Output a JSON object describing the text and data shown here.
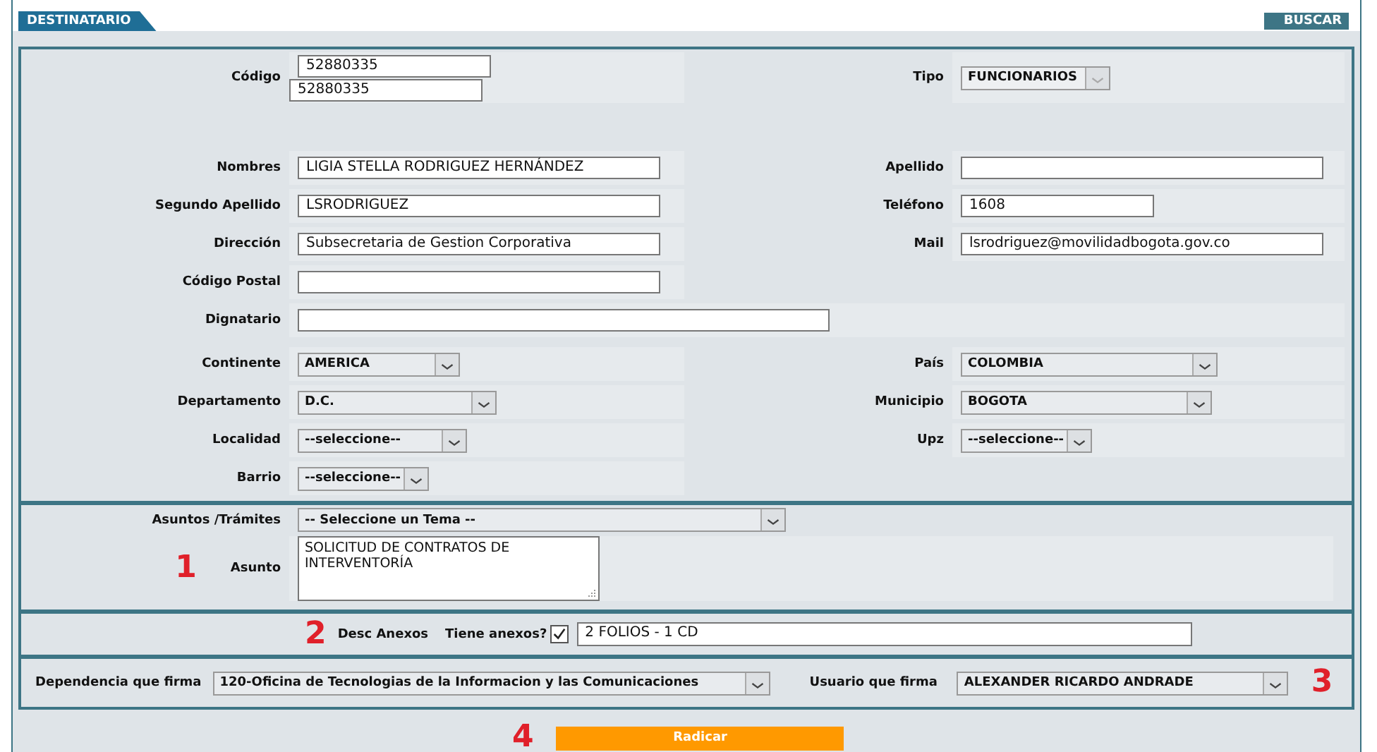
{
  "header": {
    "tab": "DESTINATARIO",
    "search_button": "BUSCAR"
  },
  "recipient": {
    "code_row": {
      "left": {
        "label": "Código",
        "kind": "double",
        "values": [
          "52880335",
          "52880335"
        ]
      },
      "right": {
        "label": "Tipo",
        "kind": "select",
        "value": "FUNCIONARIOS",
        "disabled": true
      }
    },
    "contact_rows": [
      {
        "left": {
          "label": "Nombres",
          "kind": "text",
          "value": "LIGIA STELLA RODRIGUEZ HERNÁNDEZ"
        },
        "right": {
          "label": "Apellido",
          "kind": "text"
        }
      },
      {
        "left": {
          "label": "Segundo Apellido",
          "kind": "text",
          "value": "LSRODRIGUEZ"
        },
        "right": {
          "label": "Teléfono",
          "kind": "text",
          "value": "1608"
        }
      },
      {
        "left": {
          "label": "Dirección",
          "kind": "text",
          "value": "Subsecretaria de Gestion Corporativa"
        },
        "right": {
          "label": "Mail",
          "kind": "text",
          "value": "lsrodriguez@movilidadbogota.gov.co"
        }
      },
      {
        "left": {
          "label": "Código Postal",
          "kind": "text"
        }
      },
      {
        "left": {
          "label": "Dignatario",
          "kind": "wide_text"
        }
      }
    ],
    "location_rows": [
      {
        "left": {
          "label": "Continente",
          "kind": "select",
          "value": "AMERICA",
          "disabled": false
        },
        "right": {
          "label": "País",
          "kind": "select",
          "value": "COLOMBIA",
          "disabled": false
        }
      },
      {
        "left": {
          "label": "Departamento",
          "kind": "select",
          "value": "D.C.",
          "disabled": false
        },
        "right": {
          "label": "Municipio",
          "kind": "select",
          "value": "BOGOTA",
          "disabled": false
        }
      },
      {
        "left": {
          "label": "Localidad",
          "kind": "select",
          "value": "--seleccione--",
          "disabled": false
        },
        "right": {
          "label": "Upz",
          "kind": "select",
          "value": "--seleccione--",
          "disabled": false
        }
      },
      {
        "left": {
          "label": "Barrio",
          "kind": "select",
          "value": "--seleccione--",
          "disabled": false
        }
      }
    ]
  },
  "subject": {
    "marker": "1",
    "topics": {
      "label": "Asuntos /Trámites",
      "value": "-- Seleccione un Tema --",
      "disabled": false
    },
    "subject": {
      "label": "Asunto",
      "value": "SOLICITUD DE CONTRATOS DE INTERVENTORÍA"
    }
  },
  "annexes": {
    "marker": "2",
    "label": "Desc Anexos",
    "check_label": "Tiene anexos?",
    "checked": true,
    "value": "2 FOLIOS - 1 CD"
  },
  "signature": {
    "marker": "3",
    "dependency": {
      "label": "Dependencia que firma",
      "value": "120-Oficina de Tecnologias de la Informacion y las Comunicaciones",
      "disabled": false
    },
    "user": {
      "label": "Usuario que firma",
      "value": "ALEXANDER RICARDO ANDRADE",
      "disabled": false
    }
  },
  "submit": {
    "marker": "4",
    "label": "Radicar"
  }
}
